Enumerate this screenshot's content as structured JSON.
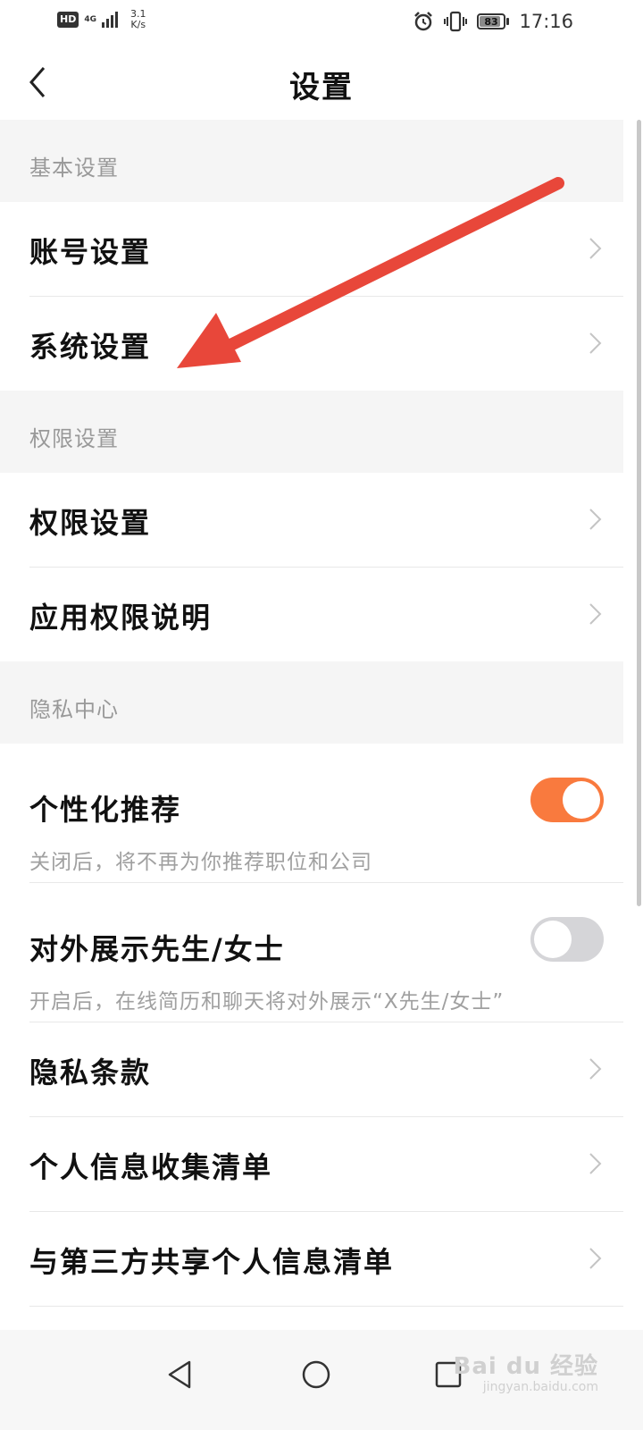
{
  "status_bar": {
    "hd": "HD",
    "network": "4G",
    "speed_value": "3.1",
    "speed_unit": "K/s",
    "battery": "83",
    "time": "17:16",
    "icons": [
      "signal-icon",
      "alarm-icon",
      "vibrate-icon",
      "battery-icon"
    ]
  },
  "header": {
    "title": "设置",
    "back_icon": "chevron-left-icon"
  },
  "sections": {
    "basic": {
      "title": "基本设置",
      "items": [
        {
          "label": "账号设置"
        },
        {
          "label": "系统设置"
        }
      ]
    },
    "permission": {
      "title": "权限设置",
      "items": [
        {
          "label": "权限设置"
        },
        {
          "label": "应用权限说明"
        }
      ]
    },
    "privacy": {
      "title": "隐私中心",
      "toggles": [
        {
          "label": "个性化推荐",
          "desc": "关闭后，将不再为你推荐职位和公司",
          "on": true
        },
        {
          "label": "对外展示先生/女士",
          "desc": "开启后，在线简历和聊天将对外展示“X先生/女士”",
          "on": false
        }
      ],
      "items": [
        {
          "label": "隐私条款"
        },
        {
          "label": "个人信息收集清单"
        },
        {
          "label": "与第三方共享个人信息清单"
        }
      ]
    }
  },
  "nav_bar": {
    "icons": [
      "back-triangle-icon",
      "home-circle-icon",
      "recents-square-icon"
    ]
  },
  "watermark": {
    "text": "Bai du 经验",
    "sub": "jingyan.baidu.com"
  },
  "colors": {
    "accent": "#f97a3e",
    "annotation_arrow": "#e8473a",
    "section_bg": "#f5f5f5"
  }
}
